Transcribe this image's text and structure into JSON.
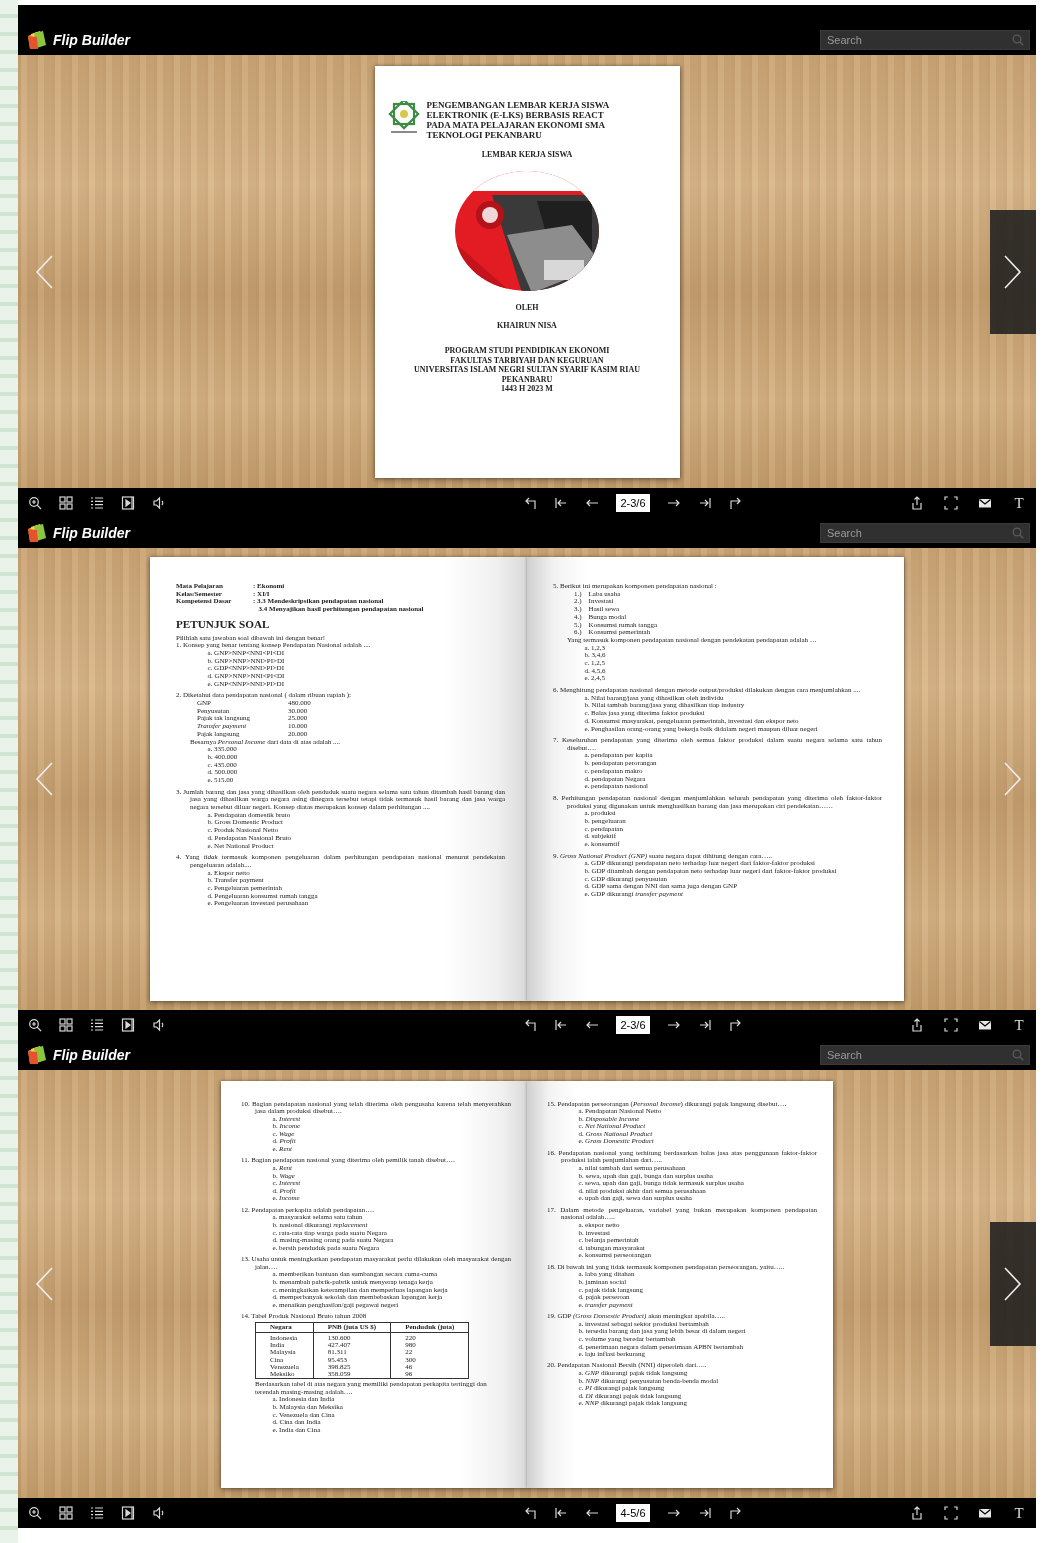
{
  "viewers": [
    {
      "brand": "Flip Builder",
      "search": {
        "placeholder": "Search"
      },
      "nav_highlight": true,
      "toolbar": {
        "page_indicator": "2-3/6",
        "text_button": "T"
      },
      "pages": [
        {
          "kind": "cover",
          "title_lines": [
            "PENGEMBANGAN LEMBAR KERJA SISWA",
            "ELEKTRONIK (E-LKS)  BERBASIS REACT",
            "PADA MATA PELAJARAN EKONOMI SMA",
            "TEKNOLOGI PEKANBARU"
          ],
          "subtitle": "LEMBAR  KERJA SISWA",
          "by": "OLEH",
          "author": "KHAIRUN NISA",
          "institution_lines": [
            "PROGRAM STUDI PENDIDIKAN EKONOMI",
            "FAKULTAS TARBIYAH DAN KEGURUAN",
            "UNIVERSITAS ISLAM NEGRI SULTAN SYARIF KASIM RIAU",
            "PEKANBARU",
            "1443 H 2023 M"
          ]
        }
      ]
    },
    {
      "brand": "Flip Builder",
      "search": {
        "placeholder": "Search"
      },
      "nav_highlight": false,
      "toolbar": {
        "page_indicator": "2-3/6",
        "text_button": "T"
      },
      "pages": [
        {
          "kind": "questions",
          "blocks": [
            {
              "kind": "meta",
              "rows": [
                {
                  "label": "Mata Pelajaran",
                  "values": [
                    ": Ekonomi"
                  ]
                },
                {
                  "label": "Kelas/Semester",
                  "values": [
                    ": XI/I"
                  ]
                },
                {
                  "label": "Kompetensi Dasar",
                  "values": [
                    ": 3.3 Mendeskripsikan pendapatan nasional",
                    "3.4 Menyajikan hasil perhitungan pendapatan nasional"
                  ]
                }
              ]
            },
            {
              "kind": "heading",
              "text": "PETUNJUK SOAL"
            },
            {
              "kind": "para",
              "text": "Pilihlah satu jawaban soal dibawah ini dengan benar!"
            },
            {
              "kind": "question",
              "number": "1.",
              "text": "Konsep yang benar tentang konsep Pendapatan Nasional  adalah ....",
              "options": [
                {
                  "label": "a.",
                  "text": "GNP>NNP<NNI<PI<DI"
                },
                {
                  "label": "b.",
                  "text": "GNP>NNP>NNI>PI>DI"
                },
                {
                  "label": "c.",
                  "text": "GDP<NNP>NNI>PI>DI"
                },
                {
                  "label": "d.",
                  "text": "GNP>NNP>NNI<PI<DI"
                },
                {
                  "label": "e.",
                  "text": "GNP<NNP>NNI>PI>DI"
                }
              ]
            },
            {
              "kind": "question",
              "number": "2.",
              "text": "Diketahui data pendapatan nasional ( dalam ribuan rupiah ):",
              "data": [
                {
                  "label": "GNP",
                  "value": "480.000"
                },
                {
                  "label": "Penyusutan",
                  "value": "30.000"
                },
                {
                  "label": "Pajak tak langsung",
                  "value": "25.000"
                },
                {
                  "label": "*Transfer payment*",
                  "value": "10.000"
                },
                {
                  "label": "Pajak langsung",
                  "value": "20.000"
                }
              ],
              "prompt": "Besarnya *Personal Income* dari data di atas adalah ....",
              "options": [
                {
                  "label": "a.",
                  "text": "335.000"
                },
                {
                  "label": "b.",
                  "text": "400.000"
                },
                {
                  "label": "c.",
                  "text": "435.000"
                },
                {
                  "label": "d.",
                  "text": "500.000"
                },
                {
                  "label": "e.",
                  "text": "515.00"
                }
              ]
            },
            {
              "kind": "question",
              "number": "3.",
              "text": "Jumlah barang dan jasa yang dihasilkan oleh penduduk suatu negara selama satu tahun ditambah hasil barang dan jasa yang dihasilkan warga negara asing dinegara tersebut tetapi tidak termasuk hasil barang dan jasa warga negara tersebut diluar negeri. Konsep diatas merupakan konsep dalam perhitungan ....",
              "options": [
                {
                  "label": "a.",
                  "text": "Pendapatan domestik bruto"
                },
                {
                  "label": "b.",
                  "text": "Gross Domestic Product"
                },
                {
                  "label": "c.",
                  "text": "Produk Nasional Netto"
                },
                {
                  "label": "d.",
                  "text": "Pendapatan Nasional Bruto"
                },
                {
                  "label": "e.",
                  "text": "Net National Product"
                }
              ]
            },
            {
              "kind": "question",
              "number": "4.",
              "text": "Yang *tidak* termasuk komponen pengeluaran dalam perhitungan pendapatan nasional menurut pendekatan pengeluaran adalah....",
              "options": [
                {
                  "label": "a.",
                  "text": "Ekspor netto"
                },
                {
                  "label": "b.",
                  "text": "Transfer payment"
                },
                {
                  "label": "c.",
                  "text": "Pengeluaran pemerintah"
                },
                {
                  "label": "d.",
                  "text": "Pengeluaran konsumsi rumah tangga"
                },
                {
                  "label": "e.",
                  "text": "Pengeluaran investasi perusahaan"
                }
              ]
            }
          ]
        },
        {
          "kind": "questions",
          "blocks": [
            {
              "kind": "question",
              "number": "5.",
              "text": "Berikut ini merupakan komponen pendapatan nasional :",
              "list": [
                {
                  "label": "1.)",
                  "text": "Laba usaha"
                },
                {
                  "label": "2.)",
                  "text": "Investasi"
                },
                {
                  "label": "3.)",
                  "text": "Hasil sewa"
                },
                {
                  "label": "4.)",
                  "text": "Bunga modal"
                },
                {
                  "label": "5.)",
                  "text": "Konsumsi rumah tangga"
                },
                {
                  "label": "6.)",
                  "text": "Konsumsi pemerintah"
                }
              ],
              "prompt": "Yang termasuk komponen pendapatan nasional dengan pendekatan pendapatan adalah …",
              "options": [
                {
                  "label": "a.",
                  "text": "1,2,3"
                },
                {
                  "label": "b.",
                  "text": "3,4,6"
                },
                {
                  "label": "c.",
                  "text": "1,2,5"
                },
                {
                  "label": "d.",
                  "text": "4,5,6"
                },
                {
                  "label": "e.",
                  "text": "2,4,5"
                }
              ]
            },
            {
              "kind": "question",
              "number": "6.",
              "text": "Menghitung pendapatan nasional dengan metode output/produksi dilakukan dengan cara menjumlahkan ....",
              "options": [
                {
                  "label": "a.",
                  "text": "Nilai barang/jasa yang dihasilkan oleh individu"
                },
                {
                  "label": "b.",
                  "text": "Nilai tambah barang/jasa yang dihasilkan tiap industry"
                },
                {
                  "label": "c.",
                  "text": "Balas jasa yang diterima faktor produksi"
                },
                {
                  "label": "d.",
                  "text": "Konsumsi masyarakat, pengeluaran pemerintah, investasi dan ekspor neto"
                },
                {
                  "label": "e.",
                  "text": "Penghasilan orang-orang yang bekerja baik didalam negeri maupun diluar negeri"
                }
              ]
            },
            {
              "kind": "question",
              "number": "7.",
              "text": "Keseluruhan pendapatan yang diterima oleh semua faktor produksi dalam suatu negara selama satu tahun disebut….",
              "options": [
                {
                  "label": "a.",
                  "text": "pendapatan per kapita"
                },
                {
                  "label": "b.",
                  "text": "pendapatan perorangan"
                },
                {
                  "label": "c.",
                  "text": "pendapatan makro"
                },
                {
                  "label": "d.",
                  "text": "pendapatan Negara"
                },
                {
                  "label": "e.",
                  "text": "pendapatan nasional"
                }
              ]
            },
            {
              "kind": "question",
              "number": "8.",
              "text": "Perhitungan pendapatan nasional dengan menjumlahkan seluruh pendapatan yang diterima oleh faktor-faktor produksi yang digunakan untuk menghasilkan barang dan jasa merupakan ciri pendekatan……",
              "options": [
                {
                  "label": "a.",
                  "text": "produksi"
                },
                {
                  "label": "b.",
                  "text": "pengeluaran"
                },
                {
                  "label": "c.",
                  "text": "pendapatan"
                },
                {
                  "label": "d.",
                  "text": "subjektif"
                },
                {
                  "label": "e.",
                  "text": "konsumtif"
                }
              ]
            },
            {
              "kind": "question",
              "number": "9.",
              "text": "*Gross National Product (GNP)* suatu negara dapat dihitung dengan cara…..",
              "options": [
                {
                  "label": "a.",
                  "text": "GDP dikurangi pendapatan neto terhadap luar negeri dari faktor-faktor produksi"
                },
                {
                  "label": "b.",
                  "text": "GDP ditambah dengan pendapatan neto terhadap luar negeri dari faktor-faktor produksi"
                },
                {
                  "label": "c.",
                  "text": "GDP dikurangi penyusutan"
                },
                {
                  "label": "d.",
                  "text": "GDP sama dengan NNI dan sama juga dengan GNP"
                },
                {
                  "label": "e.",
                  "text": "GDP dikurangi *transfer payment*"
                }
              ]
            }
          ]
        }
      ]
    },
    {
      "brand": "Flip Builder",
      "search": {
        "placeholder": "Search"
      },
      "nav_highlight": true,
      "toolbar": {
        "page_indicator": "4-5/6",
        "text_button": "T"
      },
      "pages": [
        {
          "kind": "questions",
          "blocks": [
            {
              "kind": "question",
              "number": "10.",
              "text": "Bagian pendapatan nasional yang telah diterima oleh pengusaha karena telah menyerahkan jasa dalam produksi disebut….",
              "options": [
                {
                  "label": "a.",
                  "text": "*Interest*"
                },
                {
                  "label": "b.",
                  "text": "*Income*"
                },
                {
                  "label": "c.",
                  "text": "*Wage*"
                },
                {
                  "label": "d.",
                  "text": "*Profit*"
                },
                {
                  "label": "e.",
                  "text": "*Rent*"
                }
              ]
            },
            {
              "kind": "question",
              "number": "11.",
              "text": "Bagian pendapatan nasional yang diterima oleh pemilik tanah disebut….",
              "options": [
                {
                  "label": "a.",
                  "text": "*Rent*"
                },
                {
                  "label": "b.",
                  "text": "*Wage*"
                },
                {
                  "label": "c.",
                  "text": "*Interest*"
                },
                {
                  "label": "d.",
                  "text": "*Profit*"
                },
                {
                  "label": "e.",
                  "text": "*Income*"
                }
              ]
            },
            {
              "kind": "question",
              "number": "12.",
              "text": "Pendapatan perkapita adalah pendapatan….",
              "options": [
                {
                  "label": "a.",
                  "text": "masyarakat selama satu tahun"
                },
                {
                  "label": "b.",
                  "text": "nasional dikurangi *replacement*"
                },
                {
                  "label": "c.",
                  "text": "rata-rata tiap warga pada suatu Negara"
                },
                {
                  "label": "d.",
                  "text": "masing-masing orang pada suatu Negara"
                },
                {
                  "label": "e.",
                  "text": "bersih penduduk pada suatu Negara"
                }
              ]
            },
            {
              "kind": "question",
              "number": "13.",
              "text": "Usaha untuk meningkatkan pendapatan masyarakat perlu dilakukan oleh masyarakat dengan jalan….",
              "options": [
                {
                  "label": "a.",
                  "text": "memberikan bantuan dan sumbangan secara cuma-cuma"
                },
                {
                  "label": "b.",
                  "text": "menambah pabrik-pabrik untuk menyerap tenaga kerja"
                },
                {
                  "label": "c.",
                  "text": "meningkatkan keterampilan dan memperluas lapangan kerja"
                },
                {
                  "label": "d.",
                  "text": "memperbanyak sekolah dan membebaskan lapangan kerja"
                },
                {
                  "label": "e.",
                  "text": "menaikan penghasilan/gaji pegawai negeri"
                }
              ]
            },
            {
              "kind": "question",
              "number": "14.",
              "text": "Tabel Produk Nasional Bruto tahun 2008",
              "table": {
                "columns": [
                  "Negara",
                  "PNB (juta US $)",
                  "Penduduk (juta)"
                ],
                "rows": [
                  [
                    "Indonesia",
                    "130.600",
                    "220"
                  ],
                  [
                    "India",
                    "427.407",
                    "980"
                  ],
                  [
                    "Malaysia",
                    "81.311",
                    "22"
                  ],
                  [
                    "Cina",
                    "95.453",
                    "300"
                  ],
                  [
                    "Venezuela",
                    "398.825",
                    "46"
                  ],
                  [
                    "Meksiko",
                    "358.059",
                    "96"
                  ]
                ]
              },
              "prompt": "Berdasarkan tabel di atas negara yang memiliki pendapatan perkapita tertinggi dan terendah masing-masing adalah….",
              "options": [
                {
                  "label": "a.",
                  "text": "Indonesia dan India"
                },
                {
                  "label": "b.",
                  "text": "Malaysia dan Meksika"
                },
                {
                  "label": "c.",
                  "text": "Venezuela dan Cina"
                },
                {
                  "label": "d.",
                  "text": "Cina dan India"
                },
                {
                  "label": "e.",
                  "text": "India dan Cina"
                }
              ]
            }
          ]
        },
        {
          "kind": "questions",
          "blocks": [
            {
              "kind": "question",
              "number": "15.",
              "text": "Pendapatan perseorangan (*Personal Income*) dikurangi pajak langsung disebut….",
              "options": [
                {
                  "label": "a.",
                  "text": "Pendapatan Nasional Netto"
                },
                {
                  "label": "b.",
                  "text": "*Disposable Income*"
                },
                {
                  "label": "c.",
                  "text": "*Net National Product*"
                },
                {
                  "label": "d.",
                  "text": "*Gross National Product*"
                },
                {
                  "label": "e.",
                  "text": "*Gross Domestic Product*"
                }
              ]
            },
            {
              "kind": "question",
              "number": "16.",
              "text": "Pendapatan nasional yang terhitung berdasarkan balas jasa atas penggunaan faktor-faktor produksi ialah penjumlahan dari…..",
              "options": [
                {
                  "label": "a.",
                  "text": "nilai tambah dari semua perusahaan"
                },
                {
                  "label": "b.",
                  "text": "sewa, upah dan gaji, bunga dan surplus usaha"
                },
                {
                  "label": "c.",
                  "text": "sewa, upah dan gaji, bunga tidak termasuk surplus usaha"
                },
                {
                  "label": "d.",
                  "text": "nilai produksi akhir dari semua perusahaan"
                },
                {
                  "label": "e.",
                  "text": "upah dan gaji, sewa dan surplus usaha"
                }
              ]
            },
            {
              "kind": "question",
              "number": "17.",
              "text": "Dalam metode pengeluaran, variabel yang bukan merupakan komponen pendapatan nasional adalah…..",
              "options": [
                {
                  "label": "a.",
                  "text": "ekspor netto"
                },
                {
                  "label": "b.",
                  "text": "investasi"
                },
                {
                  "label": "c.",
                  "text": "belanja pemerintah"
                },
                {
                  "label": "d.",
                  "text": "tabungan masyarakat"
                },
                {
                  "label": "e.",
                  "text": "konsumsi perseorangan"
                }
              ]
            },
            {
              "kind": "question",
              "number": "18.",
              "text": "Di bawah ini yang tidak termasuk komponen pendapatan perseorangan, yaitu…..",
              "options": [
                {
                  "label": "a.",
                  "text": "laba yang ditahan"
                },
                {
                  "label": "b.",
                  "text": "jaminan social"
                },
                {
                  "label": "c.",
                  "text": "pajak tidak langsung"
                },
                {
                  "label": "d.",
                  "text": "pajak perseroan"
                },
                {
                  "label": "e.",
                  "text": "*transfer payment*"
                }
              ]
            },
            {
              "kind": "question",
              "number": "19.",
              "text": "GDP *(Gross Domestic Product)* akan meningkat apabila…..",
              "options": [
                {
                  "label": "a.",
                  "text": "investasi sebagai sektor produksi bertambah"
                },
                {
                  "label": "b.",
                  "text": "tersedia barang dan jasa yang lebih besar di dalam negeri"
                },
                {
                  "label": "c.",
                  "text": "volume yang beredar bertambah"
                },
                {
                  "label": "d.",
                  "text": "penerimaan negara dalam penerimaan APBN bertambah"
                },
                {
                  "label": "e.",
                  "text": "laju inflasi berkurang"
                }
              ]
            },
            {
              "kind": "question",
              "number": "20.",
              "text": "Pendapatan Nasional Bersih (NNI) diperoleh dari…..",
              "options": [
                {
                  "label": "a.",
                  "text": "*GNP* dikurangi pajak tidak langsung"
                },
                {
                  "label": "b.",
                  "text": "*NNP* dikurangi penyusutan benda-benda modal"
                },
                {
                  "label": "c.",
                  "text": "*PI*  dikurangi pajak langsung"
                },
                {
                  "label": "d.",
                  "text": "*DI*  dikurangi pajak tidak langsung"
                },
                {
                  "label": "e.",
                  "text": "*NNP* dikurangi pajak tidak langsung"
                }
              ]
            }
          ]
        }
      ]
    }
  ]
}
